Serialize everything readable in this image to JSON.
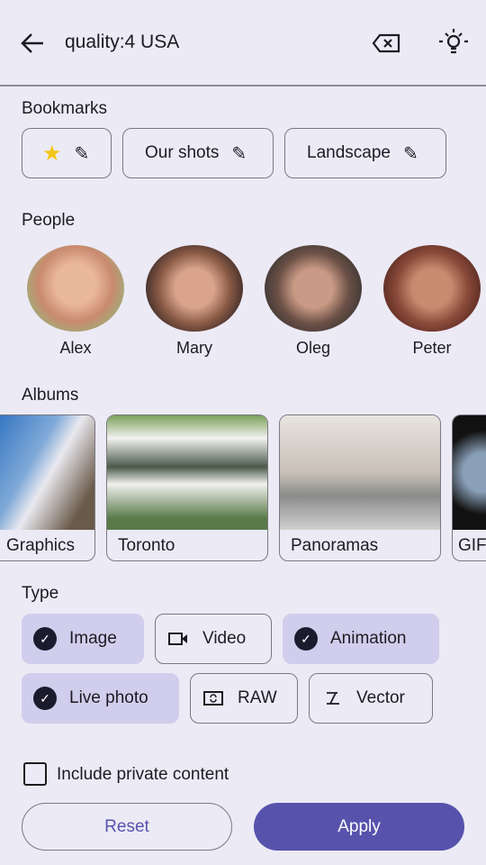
{
  "search": {
    "query": "quality:4 USA",
    "back_icon": "arrow-back-icon",
    "clear_icon": "backspace-icon",
    "hint_icon": "lightbulb-icon"
  },
  "bookmarks": {
    "title": "Bookmarks",
    "items": [
      {
        "label": "",
        "icon": "star-icon"
      },
      {
        "label": "Our shots"
      },
      {
        "label": "Landscape"
      }
    ]
  },
  "people": {
    "title": "People",
    "items": [
      {
        "name": "Alex"
      },
      {
        "name": "Mary"
      },
      {
        "name": "Oleg"
      },
      {
        "name": "Peter"
      }
    ]
  },
  "albums": {
    "title": "Albums",
    "items": [
      {
        "name": "Graphics"
      },
      {
        "name": "Toronto"
      },
      {
        "name": "Panoramas"
      },
      {
        "name": "GIF"
      }
    ]
  },
  "type": {
    "title": "Type",
    "items": [
      {
        "label": "Image",
        "selected": true
      },
      {
        "label": "Video",
        "selected": false,
        "icon": "videocam-icon"
      },
      {
        "label": "Animation",
        "selected": true
      },
      {
        "label": "Live photo",
        "selected": true
      },
      {
        "label": "RAW",
        "selected": false,
        "icon": "raw-icon"
      },
      {
        "label": "Vector",
        "selected": false,
        "icon": "vector-icon"
      }
    ]
  },
  "private": {
    "label": "Include private content",
    "checked": false
  },
  "actions": {
    "reset": "Reset",
    "apply": "Apply"
  },
  "colors": {
    "accent": "#5753ad",
    "selected_chip": "#d1cdec",
    "background": "#eceaf5"
  }
}
